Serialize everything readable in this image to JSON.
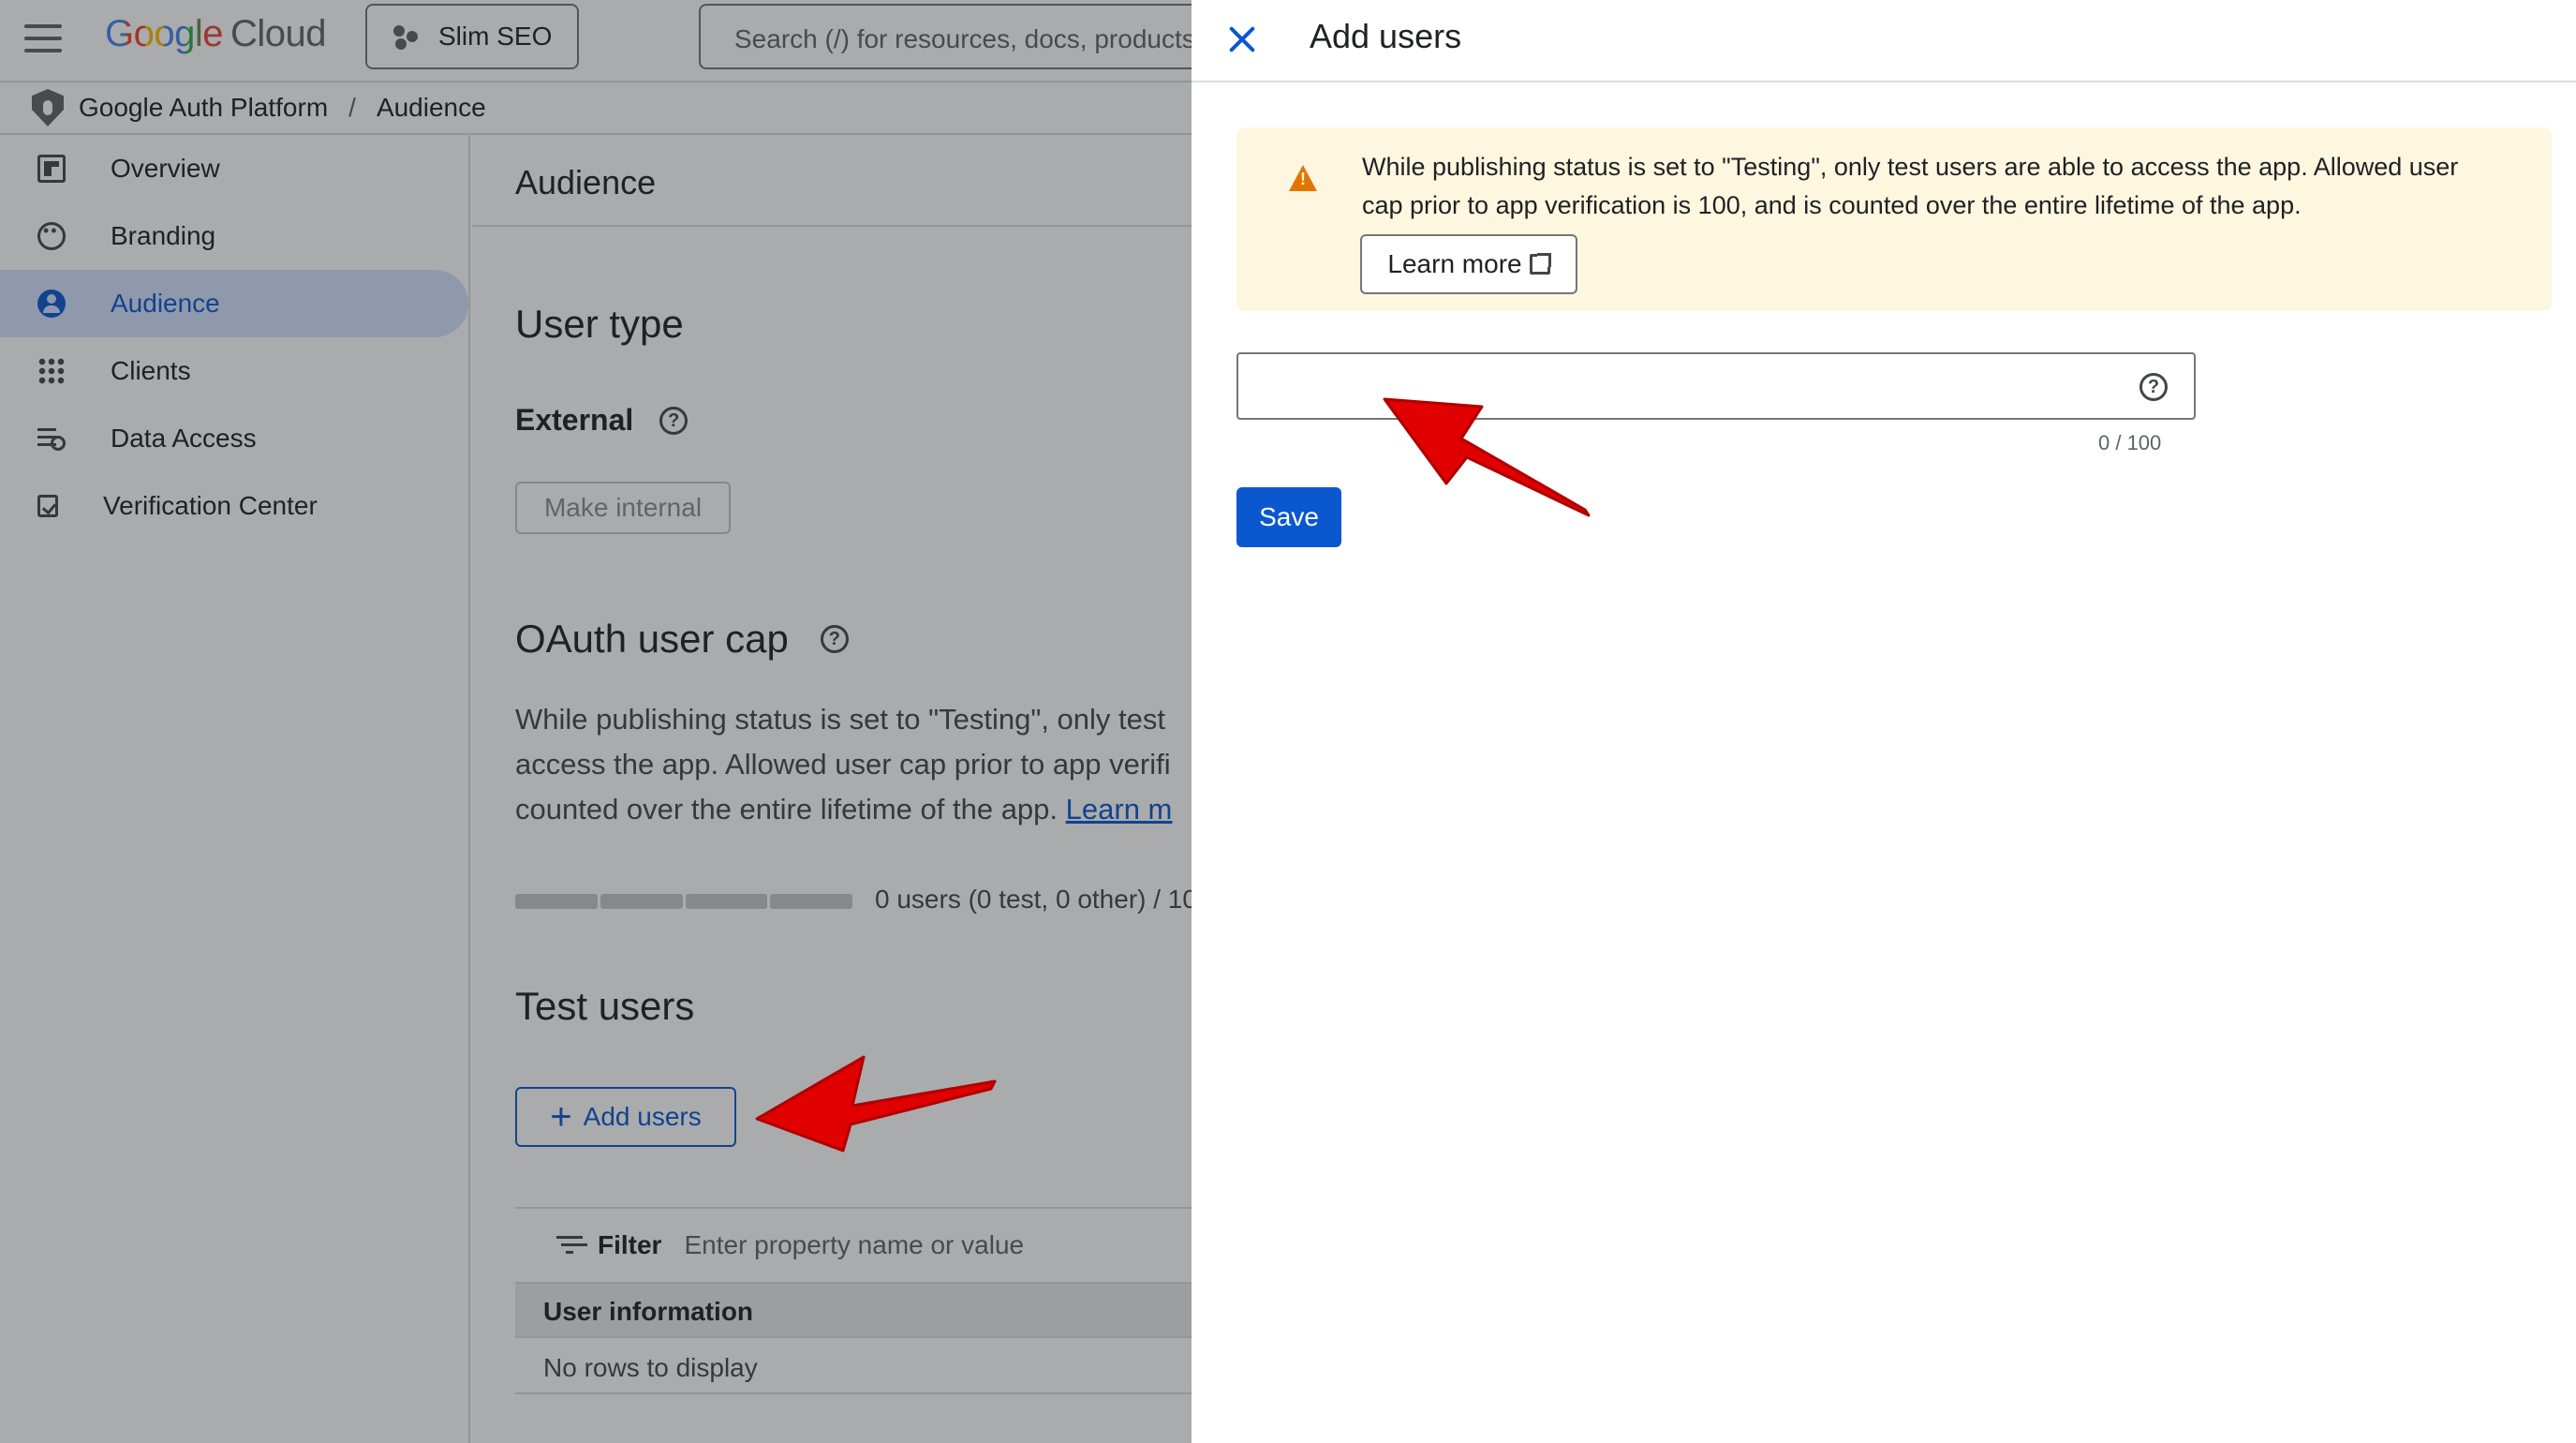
{
  "header": {
    "logo_google": "Google",
    "logo_cloud": "Cloud",
    "project_name": "Slim SEO",
    "search_placeholder": "Search (/) for resources, docs, products"
  },
  "breadcrumb": {
    "platform": "Google Auth Platform",
    "separator": "/",
    "current": "Audience"
  },
  "sidebar": {
    "items": [
      {
        "label": "Overview",
        "icon": "dashboard-icon"
      },
      {
        "label": "Branding",
        "icon": "palette-icon"
      },
      {
        "label": "Audience",
        "icon": "person-circle-icon",
        "active": true
      },
      {
        "label": "Clients",
        "icon": "grid-icon"
      },
      {
        "label": "Data Access",
        "icon": "data-settings-icon"
      },
      {
        "label": "Verification Center",
        "icon": "checkbox-icon"
      }
    ]
  },
  "main": {
    "page_title": "Audience",
    "user_type": {
      "title": "User type",
      "value": "External",
      "button": "Make internal"
    },
    "oauth": {
      "title": "OAuth user cap",
      "desc_line1": "While publishing status is set to \"Testing\", only test",
      "desc_line2": "access the app. Allowed user cap prior to app verifi",
      "desc_line3": "counted over the entire lifetime of the app.",
      "learn_link": "Learn m",
      "cap_text": "0 users (0 test, 0 other) / 10"
    },
    "test_users": {
      "title": "Test users",
      "add_button": "Add users",
      "filter_label": "Filter",
      "filter_placeholder": "Enter property name or value",
      "column_header": "User information",
      "empty_text": "No rows to display"
    }
  },
  "drawer": {
    "title": "Add users",
    "notice_line1": "While publishing status is set to \"Testing\", only test users are able to access the app. Allowed user",
    "notice_line2": "cap prior to app verification is 100, and is counted over the entire lifetime of the app.",
    "learn_more": "Learn more",
    "email_value": "",
    "counter": "0 / 100",
    "save": "Save"
  },
  "colors": {
    "accent": "#0b57d0",
    "active_nav_bg": "#d3e3fd",
    "notice_bg": "#fef7e0",
    "warning": "#e37400",
    "annotation_arrow": "#e00000"
  }
}
